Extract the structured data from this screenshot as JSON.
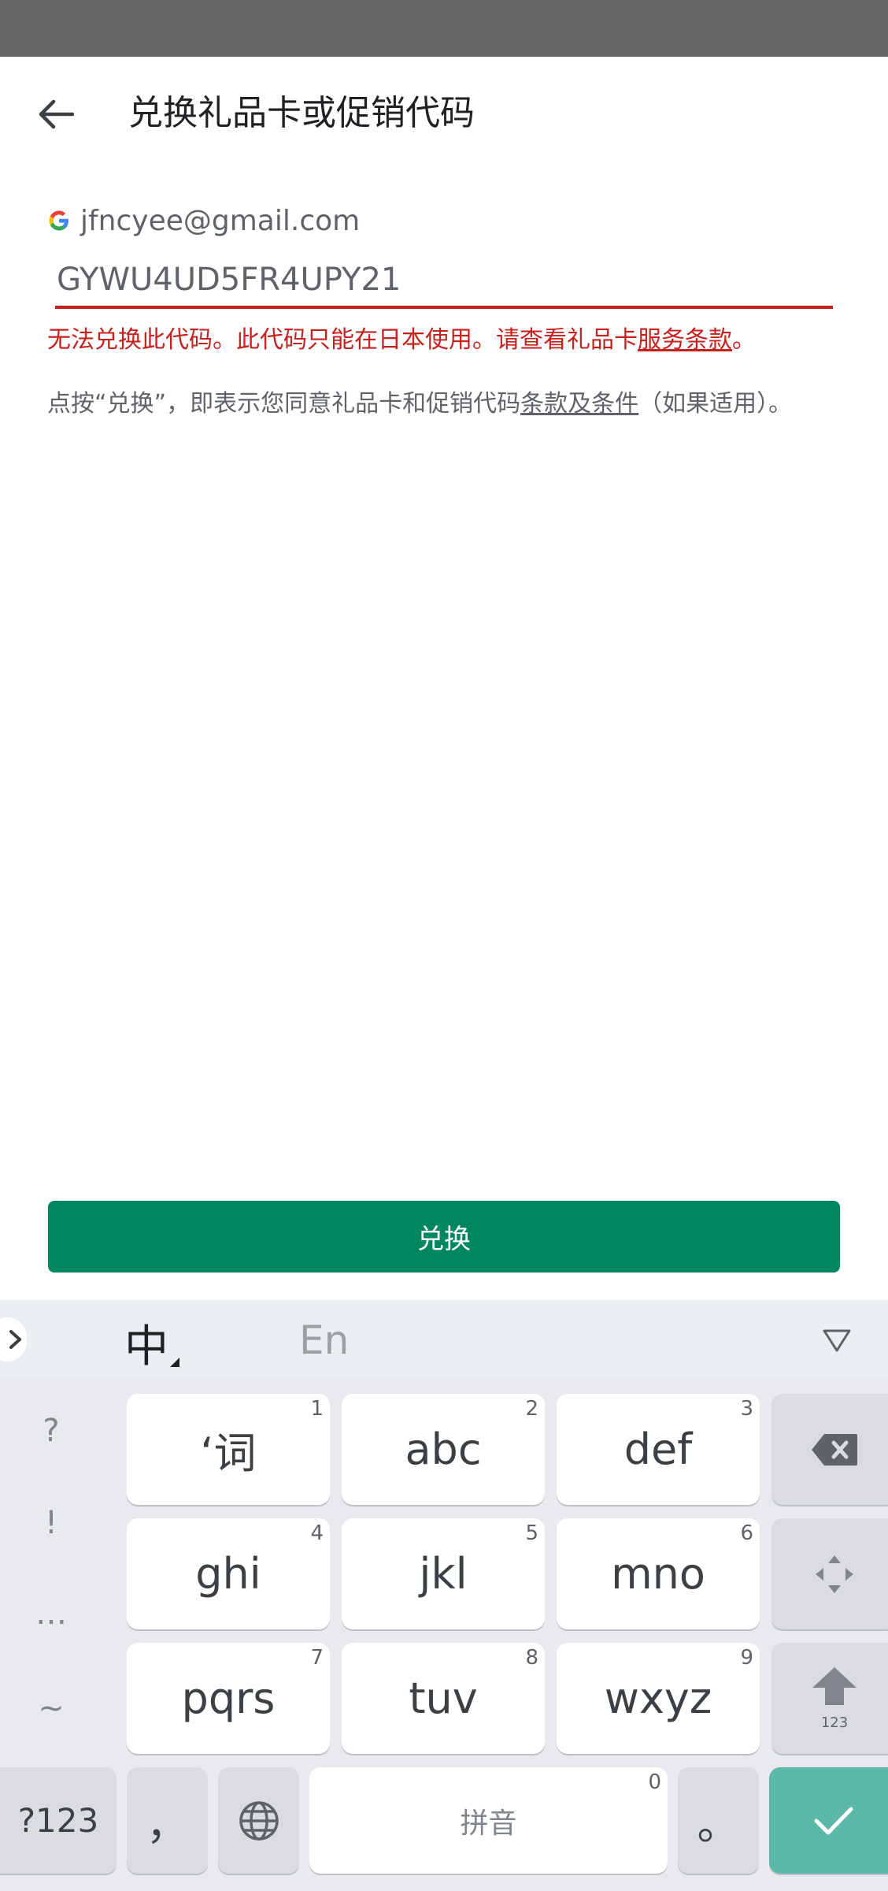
{
  "header": {
    "title": "兑换礼品卡或促销代码"
  },
  "account": {
    "email": "jfncyee@gmail.com"
  },
  "code_input": {
    "value": "GYWU4UD5FR4UPY21"
  },
  "error": {
    "prefix": "无法兑换此代码。此代码只能在日本使用。请查看礼品卡",
    "link": "服务条款",
    "suffix": "。"
  },
  "terms": {
    "prefix": "点按“兑换”，即表示您同意礼品卡和促销代码",
    "link": "条款及条件",
    "suffix": "（如果适用）。"
  },
  "redeem_button": {
    "label": "兑换"
  },
  "keyboard": {
    "lang_zh": "中",
    "lang_en": "En",
    "side_keys": [
      "?",
      "!",
      "…",
      "~"
    ],
    "keys": [
      {
        "label": "‘词",
        "num": "1"
      },
      {
        "label": "abc",
        "num": "2"
      },
      {
        "label": "def",
        "num": "3"
      },
      {
        "label": "ghi",
        "num": "4"
      },
      {
        "label": "jkl",
        "num": "5"
      },
      {
        "label": "mno",
        "num": "6"
      },
      {
        "label": "pqrs",
        "num": "7"
      },
      {
        "label": "tuv",
        "num": "8"
      },
      {
        "label": "wxyz",
        "num": "9"
      }
    ],
    "shift_sub": "123",
    "symbols_key": "?123",
    "comma_key": "，",
    "space_label": "拼音",
    "space_num": "0",
    "period_key": "。"
  },
  "colors": {
    "accent": "#01875f",
    "error": "#c5221f",
    "enter": "#5cb8a8"
  }
}
